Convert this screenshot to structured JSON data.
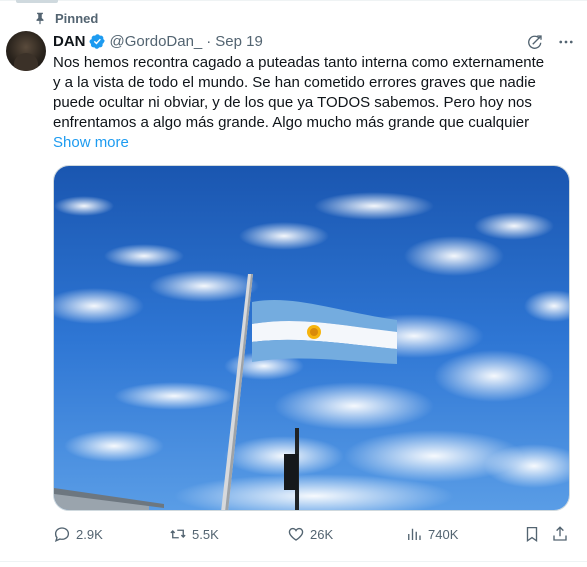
{
  "pinned": {
    "label": "Pinned",
    "icon": "pin-icon"
  },
  "author": {
    "name": "DAN",
    "handle": "@GordoDan_",
    "separator": "·",
    "date": "Sep 19",
    "verified_color": "#1d9bf0"
  },
  "tweet": {
    "text": "Nos hemos recontra cagado a puteadas tanto interna como externamente\ny a la vista de todo el mundo. Se han cometido errores graves que nadie\npuede ocultar ni obviar, y de los que ya TODOS sabemos. Pero hoy nos\nenfrentamos a algo más grande. Algo mucho más grande que cualquier",
    "show_more": "Show more"
  },
  "media": {
    "icon": "flag-photo"
  },
  "actions": {
    "replies": "2.9K",
    "reposts": "5.5K",
    "likes": "26K",
    "views": "740K"
  },
  "colors": {
    "accent": "#1d9bf0",
    "muted": "#536471",
    "text": "#0f1419"
  }
}
